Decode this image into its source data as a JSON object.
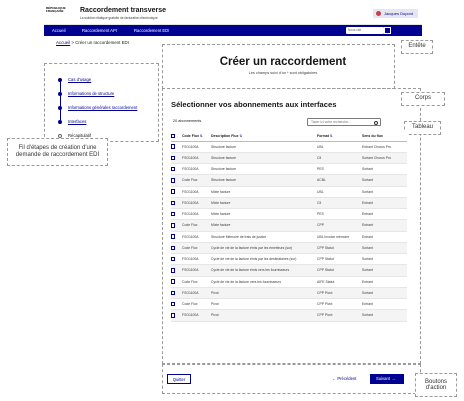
{
  "header": {
    "logo_text": [
      "RÉPUBLIQUE",
      "FRANÇAISE"
    ],
    "title": "Raccordement transverse",
    "subtitle": "La solution étatique gratuite de facturation électronique",
    "user": "Jacques Dupont"
  },
  "nav": {
    "items": [
      "Accueil",
      "Raccordement API",
      "Raccordement EDI"
    ],
    "search_placeholder": "Nous cite"
  },
  "breadcrumb": {
    "home": "Accueil",
    "separator": ">",
    "current": "Créer un raccordement EDI"
  },
  "stepper": {
    "steps": [
      {
        "label": "Cas d'usage",
        "state": "done"
      },
      {
        "label": "Informations de structure",
        "state": "done"
      },
      {
        "label": "Informations générales raccordement",
        "state": "done"
      },
      {
        "label": "Interfaces",
        "state": "current"
      },
      {
        "label": "Récapitulatif",
        "state": "todo"
      }
    ]
  },
  "main": {
    "title": "Créer un raccordement",
    "subtitle": "Les champs suivi d'un * sont obligatoires",
    "section_title": "Sélectionner vos abonnements aux interfaces",
    "count_label": "20 abonnements",
    "search_placeholder": "Taper ici votre recherche..."
  },
  "table": {
    "headers": [
      "Code Flux",
      "Description Flux",
      "Format",
      "Sens du flux"
    ],
    "rows": [
      [
        "FSO1100A",
        "Structure facture",
        "UBL",
        "Entrant Chorus Pro"
      ],
      [
        "FSO1100A",
        "Structure facture",
        "CII",
        "Sortant Chorus Pro"
      ],
      [
        "FSO1100A",
        "Structure facture",
        "PES",
        "Sortant"
      ],
      [
        "Code Flux",
        "Structure facture",
        "ACBL",
        "Sortant"
      ],
      [
        "FSO1100A",
        "Mixte facture",
        "UBL",
        "Sortant"
      ],
      [
        "FSO1100A",
        "Mixte facture",
        "CII",
        "Entrant"
      ],
      [
        "FSO1100A",
        "Mixte facture",
        "PES",
        "Entrant"
      ],
      [
        "Code Flux",
        "Mixte facture",
        "CPP",
        "Entrant"
      ],
      [
        "FSO1100A",
        "Structure Mémoire de frais de justice",
        "UBL Invoice mémoire",
        "Entrant"
      ],
      [
        "Code Flux",
        "Cycle de vie de la facture émis par les émetteurs (sur)",
        "CPP Statut",
        "Sortant"
      ],
      [
        "FSO1100A",
        "Cycle de vie de la facture émis par les destinataires (sur)",
        "CPP Statut",
        "Sortant"
      ],
      [
        "FSO1100A",
        "Cycle de vie de la facture émis vers les fournisseurs",
        "CPP Statut",
        "Sortant"
      ],
      [
        "Code Flux",
        "Cycle de vie de la facture vers les fournisseurs",
        "AIFE Statut",
        "Entrant"
      ],
      [
        "FSO1100A",
        "Pivot",
        "CPP Pivot",
        "Sortant"
      ],
      [
        "Code Flux",
        "Pivot",
        "CPP Pivot",
        "Entrant"
      ],
      [
        "FSO1100A",
        "Pivot",
        "CPP Pivot",
        "Sortant"
      ]
    ]
  },
  "actions": {
    "quit": "Quitter",
    "previous": "Précédent",
    "next": "Suivant"
  },
  "annotations": {
    "header": "Entête",
    "body": "Corps",
    "table": "Tableau",
    "stepper": "Fil d'étapes de création d'une demande de raccordement EDI",
    "buttons": "Boutons d'action"
  },
  "colors": {
    "primary": "#000091",
    "accent_red": "#c83f49"
  }
}
